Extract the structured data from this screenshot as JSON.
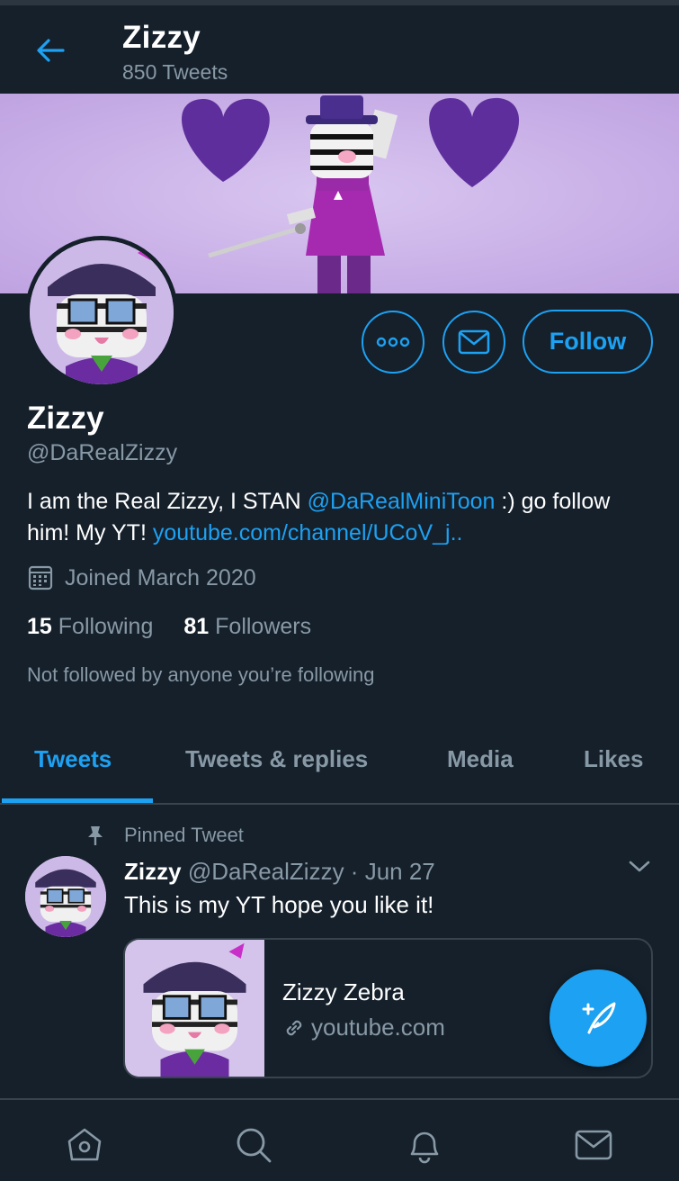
{
  "header": {
    "name": "Zizzy",
    "tweet_count": "850 Tweets"
  },
  "profile": {
    "name": "Zizzy",
    "handle": "@DaRealZizzy",
    "bio_text_1": "I am the Real Zizzy, I STAN ",
    "bio_mention": "@DaRealMiniToon",
    "bio_text_2": " :) go follow him! My YT! ",
    "bio_link": "youtube.com/channel/UCoV_j..",
    "joined": "Joined March 2020",
    "following_count": "15",
    "following_label": "Following",
    "followers_count": "81",
    "followers_label": "Followers",
    "not_followed": "Not followed by anyone you’re following",
    "follow_label": "Follow"
  },
  "tabs": [
    {
      "label": "Tweets",
      "active": true
    },
    {
      "label": "Tweets & replies",
      "active": false
    },
    {
      "label": "Media",
      "active": false
    },
    {
      "label": "Likes",
      "active": false
    }
  ],
  "tweet": {
    "pinned_label": "Pinned Tweet",
    "author": "Zizzy",
    "handle": "@DaRealZizzy",
    "sep": " · ",
    "date": "Jun 27",
    "text": "This is my YT hope you like it!",
    "card_title": "Zizzy Zebra",
    "card_url": "youtube.com"
  },
  "colors": {
    "background": "#15202b",
    "accent": "#1da1f2",
    "secondary_text": "#8899a6",
    "divider": "#38444d"
  },
  "icons": {
    "back": "arrow-left-icon",
    "more": "more-dots-icon",
    "message": "envelope-icon",
    "joined": "calendar-icon",
    "pin": "pin-icon",
    "chevron": "chevron-down-icon",
    "link": "link-icon",
    "compose": "compose-icon",
    "nav": [
      "home-icon",
      "search-icon",
      "bell-icon",
      "envelope-icon"
    ]
  }
}
